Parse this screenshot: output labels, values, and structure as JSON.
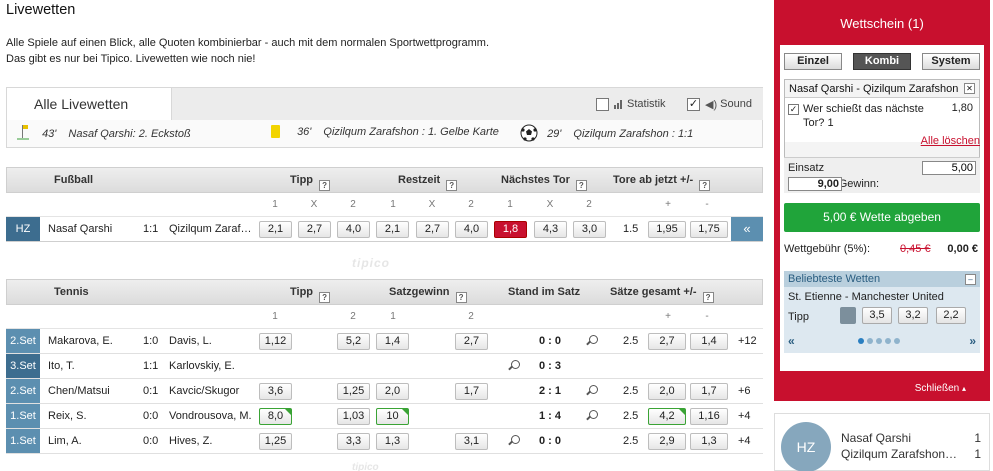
{
  "page": {
    "title": "Livewetten",
    "intro_line1": "Alle Spiele auf einen Blick, alle Quoten kombinierbar - auch mit dem normalen Sportwettprogramm.",
    "intro_line2": "Das gibt es nur bei Tipico. Livewetten wie noch nie!"
  },
  "tabs": {
    "active": "Alle Livewetten",
    "statistik": "Statistik",
    "sound": "Sound",
    "statistik_checked": false,
    "sound_checked": true
  },
  "ticker": [
    {
      "minute": "43'",
      "text": "Nasaf Qarshi: 2. Eckstoß",
      "icon": "corner-flag-icon"
    },
    {
      "minute": "36'",
      "text": "Qizilqum Zarafshon : 1. Gelbe Karte",
      "icon": "yellow-card-icon"
    },
    {
      "minute": "29'",
      "text": "Qizilqum Zarafshon : 1:1",
      "icon": "soccer-ball-icon"
    }
  ],
  "football": {
    "sport": "Fußball",
    "headers": {
      "tipp": "Tipp",
      "restzeit": "Restzeit",
      "naechstes_tor": "Nächstes Tor",
      "tore_ab_jetzt": "Tore ab jetzt +/-",
      "help": "?"
    },
    "sub": [
      "1",
      "X",
      "2",
      "1",
      "X",
      "2",
      "1",
      "X",
      "2",
      "+",
      "-"
    ],
    "rows": [
      {
        "period": "HZ",
        "home": "Nasaf Qarshi",
        "score": "1:1",
        "away": "Qizilqum Zaraf…",
        "tipp": [
          "2,1",
          "2,7",
          "4,0"
        ],
        "restzeit": [
          "2,1",
          "2,7",
          "4,0"
        ],
        "tor": [
          "1,8",
          "4,3",
          "3,0"
        ],
        "line": "1.5",
        "tore": [
          "1,95",
          "1,75"
        ],
        "more": "«"
      }
    ]
  },
  "watermark": "tipico",
  "tennis": {
    "sport": "Tennis",
    "headers": {
      "tipp": "Tipp",
      "satzgewinn": "Satzgewinn",
      "stand": "Stand im Satz",
      "saetze": "Sätze gesamt +/-",
      "help": "?"
    },
    "sub": [
      "1",
      "2",
      "1",
      "2",
      "+",
      "-"
    ],
    "rows": [
      {
        "period": "2.Set",
        "home": "Makarova, E.",
        "score": "1:0",
        "away": "Davis, L.",
        "t1": "1,12",
        "t2": "5,2",
        "s1": "1,4",
        "s2": "2,7",
        "stand": "0 : 0",
        "serve_left": false,
        "serve_right": true,
        "line": "2.5",
        "p": "2,7",
        "m": "1,4",
        "more": "+12"
      },
      {
        "period": "3.Set",
        "home": "Ito, T.",
        "score": "1:1",
        "away": "Karlovskiy, E.",
        "t1": "",
        "t2": "",
        "s1": "",
        "s2": "",
        "stand": "0 : 3",
        "serve_left": true,
        "serve_right": false,
        "line": "",
        "p": "",
        "m": "",
        "more": ""
      },
      {
        "period": "2.Set",
        "home": "Chen/Matsui",
        "score": "0:1",
        "away": "Kavcic/Skugor",
        "t1": "3,6",
        "t2": "1,25",
        "s1": "2,0",
        "s2": "1,7",
        "stand": "2 : 1",
        "serve_left": false,
        "serve_right": true,
        "line": "2.5",
        "p": "2,0",
        "m": "1,7",
        "more": "+6"
      },
      {
        "period": "1.Set",
        "home": "Reix, S.",
        "score": "0:0",
        "away": "Vondrousova, M.",
        "t1": "8,0",
        "t2": "1,03",
        "s1": "10",
        "s2": "",
        "stand": "1 : 4",
        "serve_left": false,
        "serve_right": true,
        "line": "2.5",
        "p": "4,2",
        "m": "1,16",
        "more": "+4"
      },
      {
        "period": "1.Set",
        "home": "Lim, A.",
        "score": "0:0",
        "away": "Hives, Z.",
        "t1": "1,25",
        "t2": "3,3",
        "s1": "1,3",
        "s2": "3,1",
        "stand": "0 : 0",
        "serve_left": true,
        "serve_right": false,
        "line": "2.5",
        "p": "2,9",
        "m": "1,3",
        "more": "+4"
      }
    ]
  },
  "slip": {
    "title": "Wettschein (1)",
    "modes": [
      "Einzel",
      "Kombi",
      "System"
    ],
    "bet_match": "Nasaf Qarshi - Qizilqum Zarafshon",
    "bet_question": "Wer schießt das nächste Tor? 1",
    "bet_odd": "1,80",
    "delete_all": "Alle löschen",
    "einsatz_label": "Einsatz",
    "einsatz_value": "5,00",
    "gewinn_label": "Möglicher Gewinn:",
    "gewinn_value": "9,00",
    "submit": "5,00 € Wette abgeben",
    "fee_label": "Wettgebühr (5%):",
    "fee_old": "0,45 €",
    "fee_new": "0,00 €",
    "popular_title": "Beliebteste Wetten",
    "popular_match": "St. Etienne - Manchester United",
    "popular_tip": "Tipp",
    "popular_odds": [
      "3,5",
      "3,2",
      "2,2"
    ],
    "nav_prev": "«",
    "nav_next": "»",
    "close": "Schließen"
  },
  "mini": {
    "period": "HZ",
    "home": "Nasaf Qarshi",
    "home_score": "1",
    "away": "Qizilqum Zarafshon…",
    "away_score": "1"
  },
  "colors": {
    "brand_red": "#c8102e",
    "period_blue": "#5c8fb0",
    "green": "#20a43a"
  }
}
